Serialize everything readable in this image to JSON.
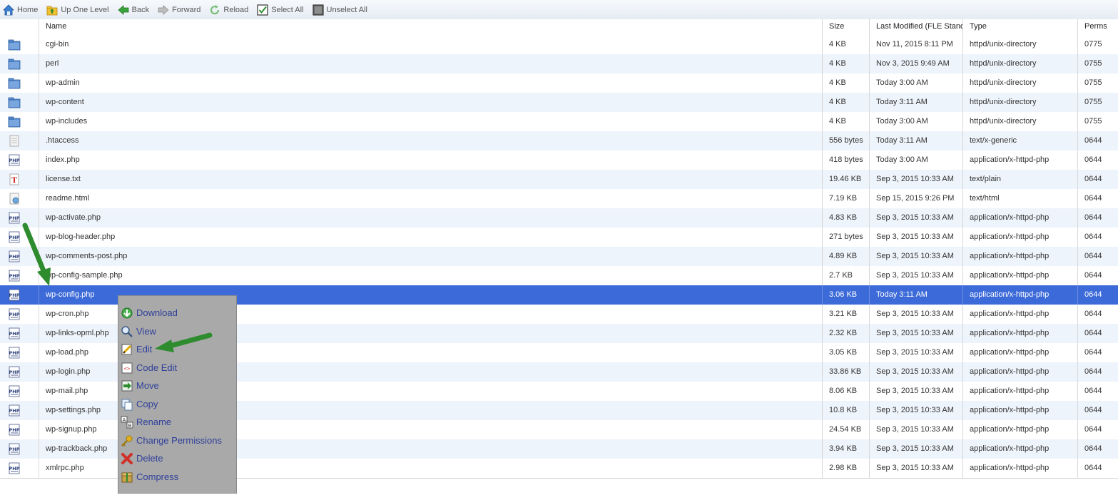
{
  "toolbar": {
    "home": "Home",
    "up_one_level": "Up One Level",
    "back": "Back",
    "forward": "Forward",
    "reload": "Reload",
    "select_all": "Select All",
    "unselect_all": "Unselect All"
  },
  "columns": {
    "name": "Name",
    "size": "Size",
    "last_modified": "Last Modified (FLE Stand",
    "type": "Type",
    "perms": "Perms"
  },
  "files": [
    {
      "icon": "folder-icon",
      "name": "cgi-bin",
      "size": "4 KB",
      "modified": "Nov 11, 2015 8:11 PM",
      "type": "httpd/unix-directory",
      "perms": "0775"
    },
    {
      "icon": "folder-icon",
      "name": "perl",
      "size": "4 KB",
      "modified": "Nov 3, 2015 9:49 AM",
      "type": "httpd/unix-directory",
      "perms": "0755"
    },
    {
      "icon": "folder-icon",
      "name": "wp-admin",
      "size": "4 KB",
      "modified": "Today 3:00 AM",
      "type": "httpd/unix-directory",
      "perms": "0755"
    },
    {
      "icon": "folder-icon",
      "name": "wp-content",
      "size": "4 KB",
      "modified": "Today 3:11 AM",
      "type": "httpd/unix-directory",
      "perms": "0755"
    },
    {
      "icon": "folder-icon",
      "name": "wp-includes",
      "size": "4 KB",
      "modified": "Today 3:00 AM",
      "type": "httpd/unix-directory",
      "perms": "0755"
    },
    {
      "icon": "generic-file-icon",
      "name": ".htaccess",
      "size": "556 bytes",
      "modified": "Today 3:11 AM",
      "type": "text/x-generic",
      "perms": "0644"
    },
    {
      "icon": "php-file-icon",
      "name": "index.php",
      "size": "418 bytes",
      "modified": "Today 3:00 AM",
      "type": "application/x-httpd-php",
      "perms": "0644"
    },
    {
      "icon": "text-file-icon",
      "name": "license.txt",
      "size": "19.46 KB",
      "modified": "Sep 3, 2015 10:33 AM",
      "type": "text/plain",
      "perms": "0644"
    },
    {
      "icon": "html-file-icon",
      "name": "readme.html",
      "size": "7.19 KB",
      "modified": "Sep 15, 2015 9:26 PM",
      "type": "text/html",
      "perms": "0644"
    },
    {
      "icon": "php-file-icon",
      "name": "wp-activate.php",
      "size": "4.83 KB",
      "modified": "Sep 3, 2015 10:33 AM",
      "type": "application/x-httpd-php",
      "perms": "0644"
    },
    {
      "icon": "php-file-icon",
      "name": "wp-blog-header.php",
      "size": "271 bytes",
      "modified": "Sep 3, 2015 10:33 AM",
      "type": "application/x-httpd-php",
      "perms": "0644"
    },
    {
      "icon": "php-file-icon",
      "name": "wp-comments-post.php",
      "size": "4.89 KB",
      "modified": "Sep 3, 2015 10:33 AM",
      "type": "application/x-httpd-php",
      "perms": "0644"
    },
    {
      "icon": "php-file-icon",
      "name": "wp-config-sample.php",
      "size": "2.7 KB",
      "modified": "Sep 3, 2015 10:33 AM",
      "type": "application/x-httpd-php",
      "perms": "0644"
    },
    {
      "icon": "php-file-icon",
      "name": "wp-config.php",
      "size": "3.06 KB",
      "modified": "Today 3:11 AM",
      "type": "application/x-httpd-php",
      "perms": "0644",
      "selected": true
    },
    {
      "icon": "php-file-icon",
      "name": "wp-cron.php",
      "size": "3.21 KB",
      "modified": "Sep 3, 2015 10:33 AM",
      "type": "application/x-httpd-php",
      "perms": "0644"
    },
    {
      "icon": "php-file-icon",
      "name": "wp-links-opml.php",
      "size": "2.32 KB",
      "modified": "Sep 3, 2015 10:33 AM",
      "type": "application/x-httpd-php",
      "perms": "0644"
    },
    {
      "icon": "php-file-icon",
      "name": "wp-load.php",
      "size": "3.05 KB",
      "modified": "Sep 3, 2015 10:33 AM",
      "type": "application/x-httpd-php",
      "perms": "0644"
    },
    {
      "icon": "php-file-icon",
      "name": "wp-login.php",
      "size": "33.86 KB",
      "modified": "Sep 3, 2015 10:33 AM",
      "type": "application/x-httpd-php",
      "perms": "0644"
    },
    {
      "icon": "php-file-icon",
      "name": "wp-mail.php",
      "size": "8.06 KB",
      "modified": "Sep 3, 2015 10:33 AM",
      "type": "application/x-httpd-php",
      "perms": "0644"
    },
    {
      "icon": "php-file-icon",
      "name": "wp-settings.php",
      "size": "10.8 KB",
      "modified": "Sep 3, 2015 10:33 AM",
      "type": "application/x-httpd-php",
      "perms": "0644"
    },
    {
      "icon": "php-file-icon",
      "name": "wp-signup.php",
      "size": "24.54 KB",
      "modified": "Sep 3, 2015 10:33 AM",
      "type": "application/x-httpd-php",
      "perms": "0644"
    },
    {
      "icon": "php-file-icon",
      "name": "wp-trackback.php",
      "size": "3.94 KB",
      "modified": "Sep 3, 2015 10:33 AM",
      "type": "application/x-httpd-php",
      "perms": "0644"
    },
    {
      "icon": "php-file-icon",
      "name": "xmlrpc.php",
      "size": "2.98 KB",
      "modified": "Sep 3, 2015 10:33 AM",
      "type": "application/x-httpd-php",
      "perms": "0644"
    }
  ],
  "context_menu": [
    {
      "icon": "download-icon",
      "label": "Download"
    },
    {
      "icon": "view-icon",
      "label": "View"
    },
    {
      "icon": "edit-icon",
      "label": "Edit"
    },
    {
      "icon": "code-edit-icon",
      "label": "Code Edit"
    },
    {
      "icon": "move-icon",
      "label": "Move"
    },
    {
      "icon": "copy-icon",
      "label": "Copy"
    },
    {
      "icon": "rename-icon",
      "label": "Rename"
    },
    {
      "icon": "key-icon",
      "label": "Change Permissions"
    },
    {
      "icon": "delete-icon",
      "label": "Delete"
    },
    {
      "icon": "compress-icon",
      "label": "Compress"
    }
  ],
  "colors": {
    "selected_row": "#3c6ad8",
    "alt_row": "#eef4fb",
    "menu_bg": "#a9a9a9",
    "menu_text": "#2f3f9a",
    "annotation_arrow": "#2e8b2e"
  }
}
